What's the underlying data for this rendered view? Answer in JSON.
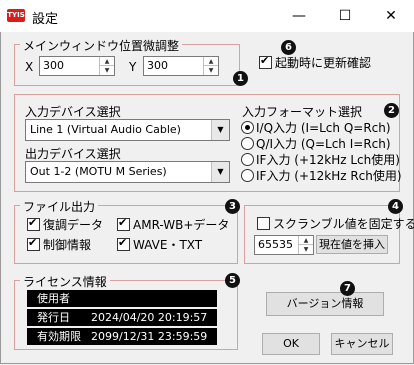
{
  "window": {
    "title": "設定",
    "icon_text": "TYIS",
    "minimize": "—",
    "maximize": "☐",
    "close": "✕"
  },
  "main_window_position": {
    "label": "メインウィンドウ位置微調整",
    "x_label": "X",
    "x_value": "300",
    "y_label": "Y",
    "y_value": "300"
  },
  "update_check": {
    "label": "起動時に更新確認",
    "checked": true
  },
  "input_device": {
    "label": "入力デバイス選択",
    "value": "Line 1 (Virtual Audio Cable)"
  },
  "output_device": {
    "label": "出力デバイス選択",
    "value": "Out 1-2 (MOTU M Series)"
  },
  "input_format": {
    "label": "入力フォーマット選択",
    "options": [
      "I/Q入力 (I=Lch Q=Rch)",
      "Q/I入力 (Q=Lch I=Rch)",
      "IF入力 (+12kHz Lch使用)",
      "IF入力 (+12kHz Rch使用)"
    ],
    "selected": 0
  },
  "file_output": {
    "label": "ファイル出力",
    "items": [
      {
        "label": "復調データ",
        "checked": true
      },
      {
        "label": "AMR-WB+データ",
        "checked": true
      },
      {
        "label": "制御情報",
        "checked": true
      },
      {
        "label": "WAVE・TXT",
        "checked": true
      }
    ]
  },
  "scramble": {
    "label": "スクランブル値を固定する",
    "checked": false,
    "value": "65535",
    "insert_button": "現在値を挿入"
  },
  "license": {
    "label": "ライセンス情報",
    "rows": [
      {
        "key": "使用者",
        "value": ""
      },
      {
        "key": "発行日",
        "value": "2024/04/20 20:19:57"
      },
      {
        "key": "有効期限",
        "value": "2099/12/31 23:59:59"
      }
    ]
  },
  "buttons": {
    "version": "バージョン情報",
    "ok": "OK",
    "cancel": "キャンセル"
  },
  "badges": [
    "1",
    "2",
    "3",
    "4",
    "5",
    "6",
    "7"
  ],
  "colors": {
    "group_border": "#d8a0a0",
    "badge": "#111111",
    "app_icon": "#d91c1c"
  }
}
